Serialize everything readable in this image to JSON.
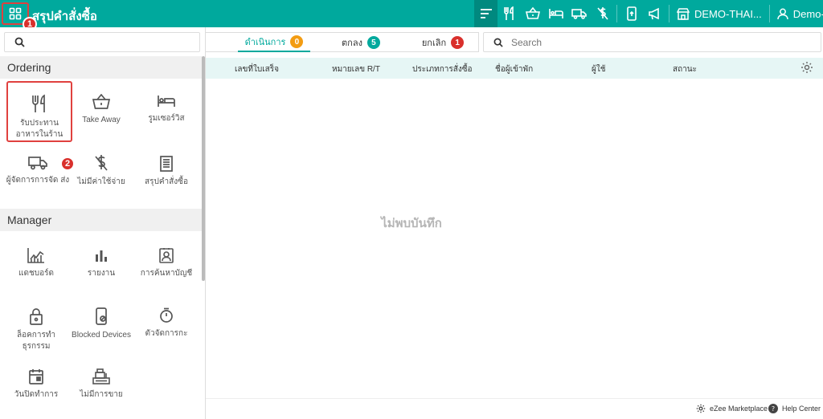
{
  "topbar": {
    "title": "สรุปคำสั่งซื้อ",
    "step1": "1",
    "property": "DEMO-THAI...",
    "user": "Demo- Thail..."
  },
  "drawer": {
    "search_placeholder": "",
    "sections": [
      {
        "title": "Ordering",
        "items": [
          {
            "label": "รับประทาน อาหารในร้าน",
            "icon": "dine-in-icon"
          },
          {
            "label": "Take Away",
            "icon": "basket-icon"
          },
          {
            "label": "รูมเซอร์วิส",
            "icon": "bed-icon"
          },
          {
            "label": "ผู้จัดการการจัด ส่ง",
            "icon": "truck-icon"
          },
          {
            "label": "ไม่มีค่าใช้จ่าย",
            "icon": "no-charge-icon"
          },
          {
            "label": "สรุปคำสั่งซื้อ",
            "icon": "receipt-icon"
          }
        ]
      },
      {
        "title": "Manager",
        "items": [
          {
            "label": "แดชบอร์ด",
            "icon": "dashboard-icon"
          },
          {
            "label": "รายงาน",
            "icon": "report-icon"
          },
          {
            "label": "การค้นหาบัญชี",
            "icon": "account-search-icon"
          },
          {
            "label": "ล็อคการทำ ธุรกรรม",
            "icon": "lock-icon"
          },
          {
            "label": "Blocked Devices",
            "icon": "blocked-device-icon"
          },
          {
            "label": "ตัวจัดการกะ",
            "icon": "timer-icon"
          },
          {
            "label": "วันปิดทำการ",
            "icon": "calendar-icon"
          },
          {
            "label": "ไม่มีการขาย",
            "icon": "register-icon"
          }
        ]
      }
    ],
    "step2": "2"
  },
  "tabs": [
    {
      "label": "ดำเนินการ",
      "count": "0",
      "color": "#f39c12"
    },
    {
      "label": "ตกลง",
      "count": "5",
      "color": "#00a99d"
    },
    {
      "label": "ยกเลิก",
      "count": "1",
      "color": "#d9302c"
    }
  ],
  "search": {
    "placeholder": "Search"
  },
  "table": {
    "columns": [
      "เลขที่ใบเสร็จ",
      "หมายเลข R/T",
      "ประเภทการสั่งซื้อ",
      "ชื่อผู้เข้าพัก",
      "ผู้ใช้",
      "สถานะ"
    ],
    "empty_message": "ไม่พบบันทึก"
  },
  "footer": {
    "marketplace": "eZee Marketplace",
    "help": "Help Center"
  },
  "colors": {
    "accent": "#00a99d",
    "alert": "#d9302c"
  }
}
